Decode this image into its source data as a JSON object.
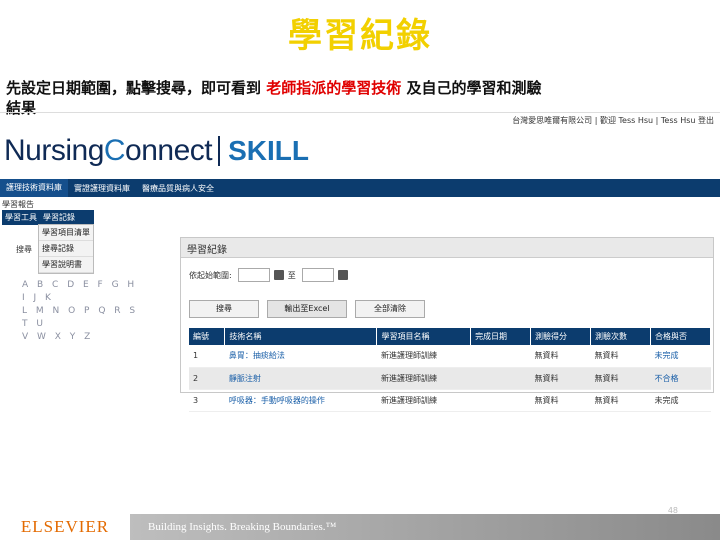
{
  "slide": {
    "title": "學習紀錄",
    "instruction_prefix": "先設定日期範圍，點擊搜尋，即可看到",
    "instruction_highlight": "老師指派的學習技術",
    "instruction_suffix": "及自己的學習和測驗",
    "instruction_line2": "結果"
  },
  "app": {
    "top_link": "台灣愛思唯爾有限公司 | 歡迎 Tess Hsu | Tess Hsu 登出",
    "logo_nursing": "Nursing",
    "logo_connect_c": "C",
    "logo_connect_rest": "onnect",
    "logo_skill": "SKILL",
    "nav": [
      "護理技術資料庫",
      "實證護理資料庫",
      "醫療品質與病人安全"
    ],
    "breadcrumb": "學習報告",
    "side_tab": "學習工具",
    "side_selected": "學習記錄",
    "side_options": [
      "學習項目清單",
      "搜尋記錄",
      "學習說明書"
    ],
    "search_label": "搜尋",
    "alphabet_rows": [
      "A B C D E F G H I J K",
      "L M N O P Q R S T U",
      "V W X Y Z"
    ],
    "panel_title": "學習紀錄",
    "date_label": "依起始範圍:",
    "date_sep": "至",
    "buttons": {
      "search": "搜尋",
      "export": "輸出至Excel",
      "clear": "全部清除"
    },
    "table": {
      "headers": [
        "編號",
        "技術名稱",
        "學習項目名稱",
        "完成日期",
        "測驗得分",
        "測驗次數",
        "合格與否"
      ],
      "rows": [
        [
          "1",
          "鼻胃：抽痰給法",
          "新進護理師訓練",
          "",
          "無資料",
          "無資料",
          "未完成"
        ],
        [
          "2",
          "靜脈注射",
          "新進護理師訓練",
          "",
          "無資料",
          "無資料",
          "不合格"
        ],
        [
          "3",
          "呼吸器：手動呼吸器的操作",
          "新進護理師訓練",
          "",
          "無資料",
          "無資料",
          "未完成"
        ]
      ]
    }
  },
  "footer": {
    "brand": "ELSEVIER",
    "tagline": "Building Insights. Breaking Boundaries.™",
    "page": "48"
  },
  "colors": {
    "title": "#f2d000",
    "highlight": "#e00000",
    "nav": "#0c3c6e",
    "brand_orange": "#e36a00"
  }
}
